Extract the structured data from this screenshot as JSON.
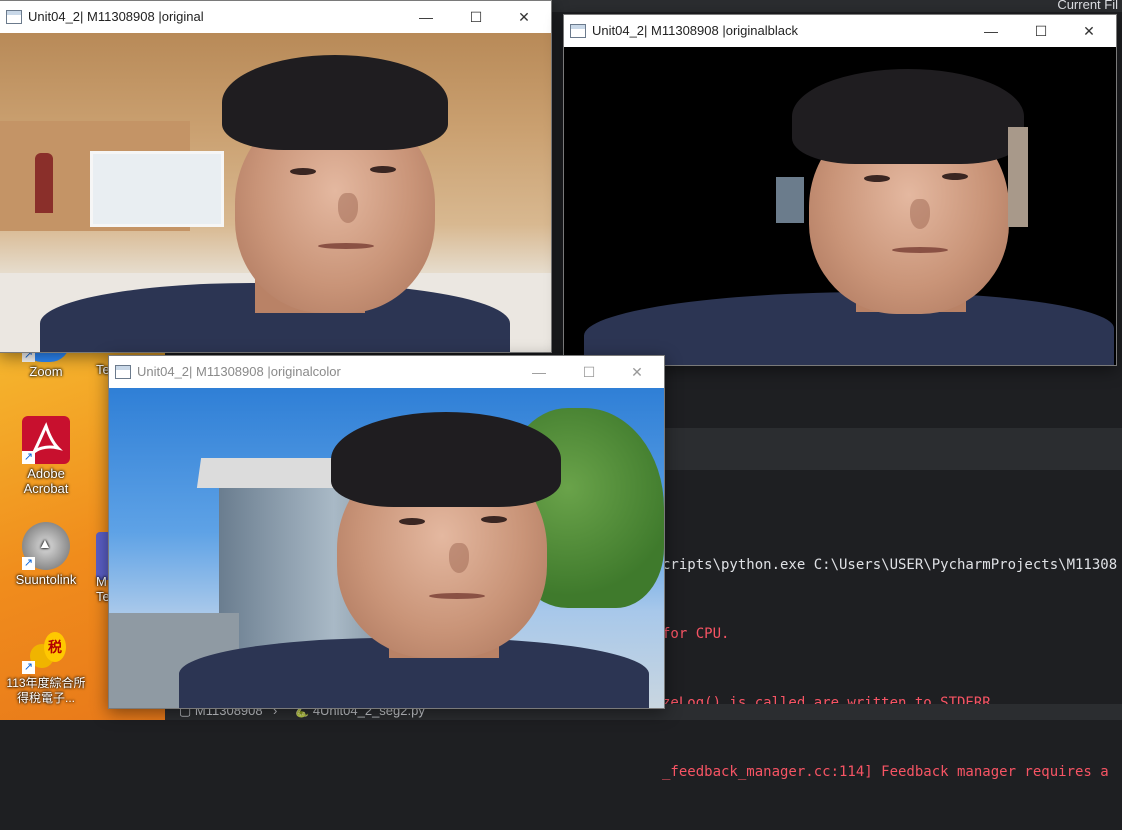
{
  "ide": {
    "top_right": "Current Fil",
    "console_lines": [
      "cripts\\python.exe C:\\Users\\USER\\PycharmProjects\\M11308",
      "for CPU.",
      "zeLog() is called are written to STDERR",
      "_feedback_manager.cc:114] Feedback manager requires a"
    ],
    "status_project": "M11308908",
    "status_file": "4Unit04_2_seg2.py"
  },
  "desktop": {
    "icons": [
      {
        "label": "Zoom"
      },
      {
        "label": "Adobe Acrobat"
      },
      {
        "label": "Suuntolink"
      },
      {
        "label": "113年度綜合所得稅電子..."
      }
    ],
    "partial_labels": [
      "Te",
      "M",
      "Tea"
    ]
  },
  "windows": {
    "original": {
      "title": "Unit04_2| M11308908  |original"
    },
    "originalblack": {
      "title": "Unit04_2| M11308908 |originalblack"
    },
    "originalcolor": {
      "title": "Unit04_2| M11308908  |originalcolor"
    }
  },
  "controls": {
    "minimize": "—",
    "maximize": "☐",
    "close": "✕"
  },
  "colors": {
    "ide_bg": "#1e1f22",
    "error_text": "#f75464",
    "desktop_orange": "#f08c1c"
  }
}
